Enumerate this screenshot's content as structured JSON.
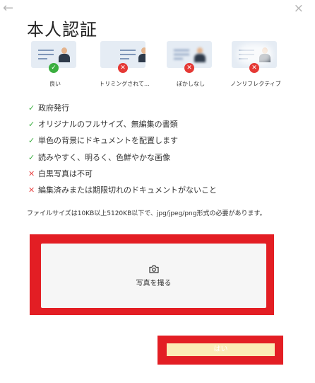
{
  "title": "本人認証",
  "examples": [
    {
      "label": "良い",
      "status": "ok"
    },
    {
      "label": "トリミングされて...",
      "status": "ng"
    },
    {
      "label": "ぼかしなし",
      "status": "ng"
    },
    {
      "label": "ノンリフレクティブ",
      "status": "ng"
    }
  ],
  "rules": [
    {
      "text": "政府発行",
      "status": "ok"
    },
    {
      "text": "オリジナルのフルサイズ、無編集の書類",
      "status": "ok"
    },
    {
      "text": "単色の背景にドキュメントを配置します",
      "status": "ok"
    },
    {
      "text": "読みやすく、明るく、色鮮やかな画像",
      "status": "ok"
    },
    {
      "text": "白黒写真は不可",
      "status": "ng"
    },
    {
      "text": "編集済みまたは期限切れのドキュメントがないこと",
      "status": "ng"
    }
  ],
  "marks": {
    "ok": "✓",
    "ng": "✕"
  },
  "note": "ファイルサイズは10KB以上5120KB以下で、jpg/jpeg/png形式の必要があります。",
  "upload": {
    "label": "写真を撮る",
    "icon": "camera-icon"
  },
  "confirm": {
    "label": "はい"
  },
  "nav": {
    "back": "←",
    "close": "×"
  },
  "colors": {
    "ok": "#3aae3f",
    "ng": "#e53935",
    "highlight": "#e31e24",
    "confirm_bg": "#fcebb6"
  }
}
